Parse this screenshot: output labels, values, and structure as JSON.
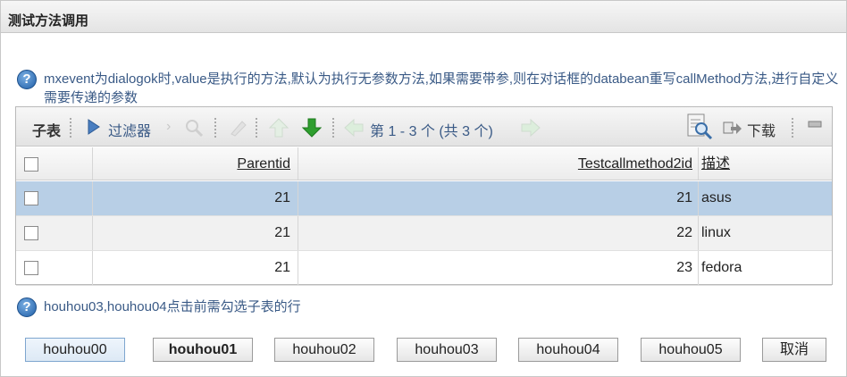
{
  "window": {
    "title": "测试方法调用"
  },
  "hints": {
    "top": "mxevent为dialogok时,value是执行的方法,默认为执行无参数方法,如果需要带参,则在对话框的databean重写callMethod方法,进行自定义需要传递的参数",
    "bottom": "houhou03,houhou04点击前需勾选子表的行"
  },
  "grid": {
    "toolbar": {
      "title": "子表",
      "filter": "过滤器",
      "pager": "第 1 - 3 个  (共 3 个)",
      "download": "下载"
    },
    "columns": [
      "Parentid",
      "Testcallmethod2id",
      "描述"
    ],
    "rows": [
      {
        "parentid": "21",
        "testcallmethod2id": "21",
        "desc": "asus",
        "selected": true
      },
      {
        "parentid": "21",
        "testcallmethod2id": "22",
        "desc": "linux",
        "selected": false
      },
      {
        "parentid": "21",
        "testcallmethod2id": "23",
        "desc": "fedora",
        "selected": false
      }
    ]
  },
  "buttons": [
    "houhou00",
    "houhou01",
    "houhou02",
    "houhou03",
    "houhou04",
    "houhou05",
    "取消"
  ],
  "colors": {
    "selected_row": "#b8cfe6",
    "hint_text": "#3a5a86",
    "add_arrow": "#2e9e2e"
  },
  "icons": [
    "help-icon",
    "filter-play-icon",
    "search-icon",
    "edit-icon",
    "up-arrow-icon",
    "down-arrow-icon",
    "prev-page-icon",
    "next-page-icon",
    "report-search-icon",
    "download-icon",
    "minimize-icon"
  ]
}
